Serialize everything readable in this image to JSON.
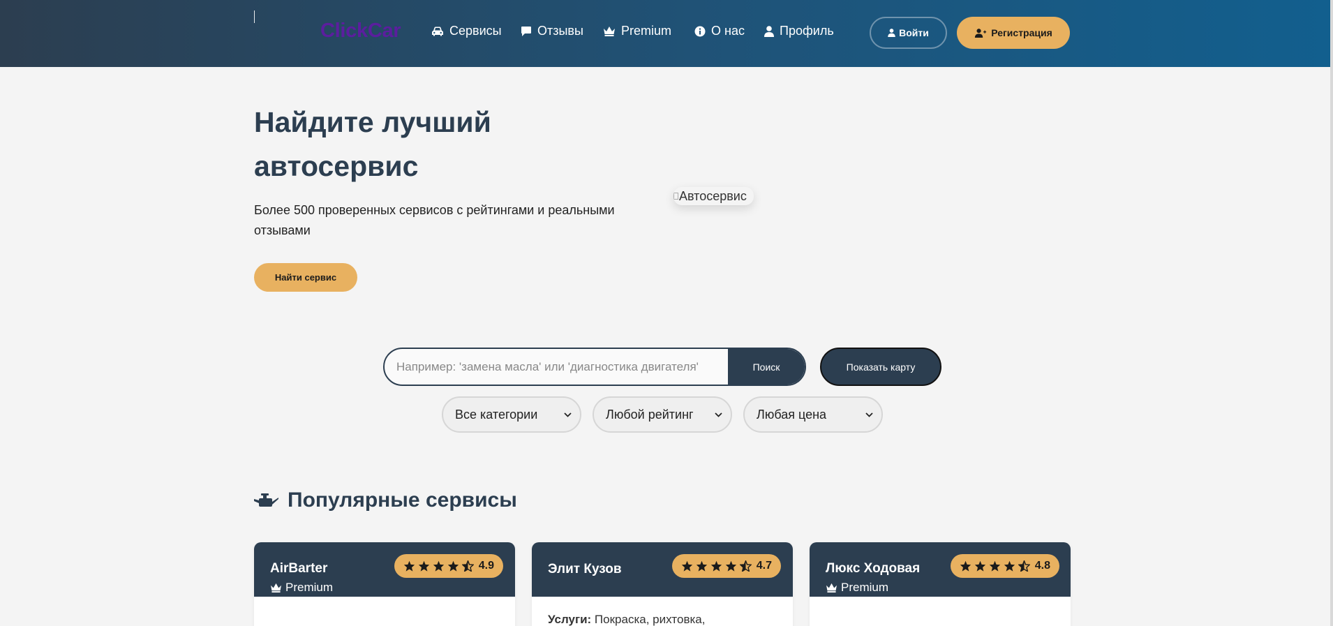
{
  "header": {
    "logo": "ClickCar",
    "nav": [
      {
        "label": "Сервисы",
        "icon": "car-icon"
      },
      {
        "label": "Отзывы",
        "icon": "comment-icon"
      },
      {
        "label": "Premium",
        "icon": "crown-icon"
      },
      {
        "label": "О нас",
        "icon": "info-icon"
      },
      {
        "label": "Профиль",
        "icon": "user-icon"
      }
    ],
    "login_label": "Войти",
    "register_label": "Регистрация"
  },
  "hero": {
    "title": "Найдите лучший автосервис",
    "subtitle": "Более 500 проверенных сервисов с рейтингами и реальными отзывами",
    "cta_label": "Найти сервис",
    "image_alt": "Автосервис"
  },
  "search": {
    "placeholder": "Например: 'замена масла' или 'диагностика двигателя'",
    "button_label": "Поиск",
    "map_button_label": "Показать карту",
    "filters": {
      "category": "Все категории",
      "rating": "Любой рейтинг",
      "price": "Любая цена"
    }
  },
  "popular": {
    "title": "Популярные сервисы",
    "cards": [
      {
        "name": "AirBarter",
        "rating": "4.9",
        "premium_label": "Premium",
        "body_label": "",
        "body_text": ""
      },
      {
        "name": "Элит Кузов",
        "rating": "4.7",
        "premium_label": "",
        "body_label": "Услуги:",
        "body_text": "Покраска, рихтовка,"
      },
      {
        "name": "Люкс Ходовая",
        "rating": "4.8",
        "premium_label": "Premium",
        "body_label": "",
        "body_text": ""
      }
    ]
  },
  "colors": {
    "accent": "#e8b160",
    "primary": "#2c3e50",
    "logo": "#5b1e9e"
  }
}
